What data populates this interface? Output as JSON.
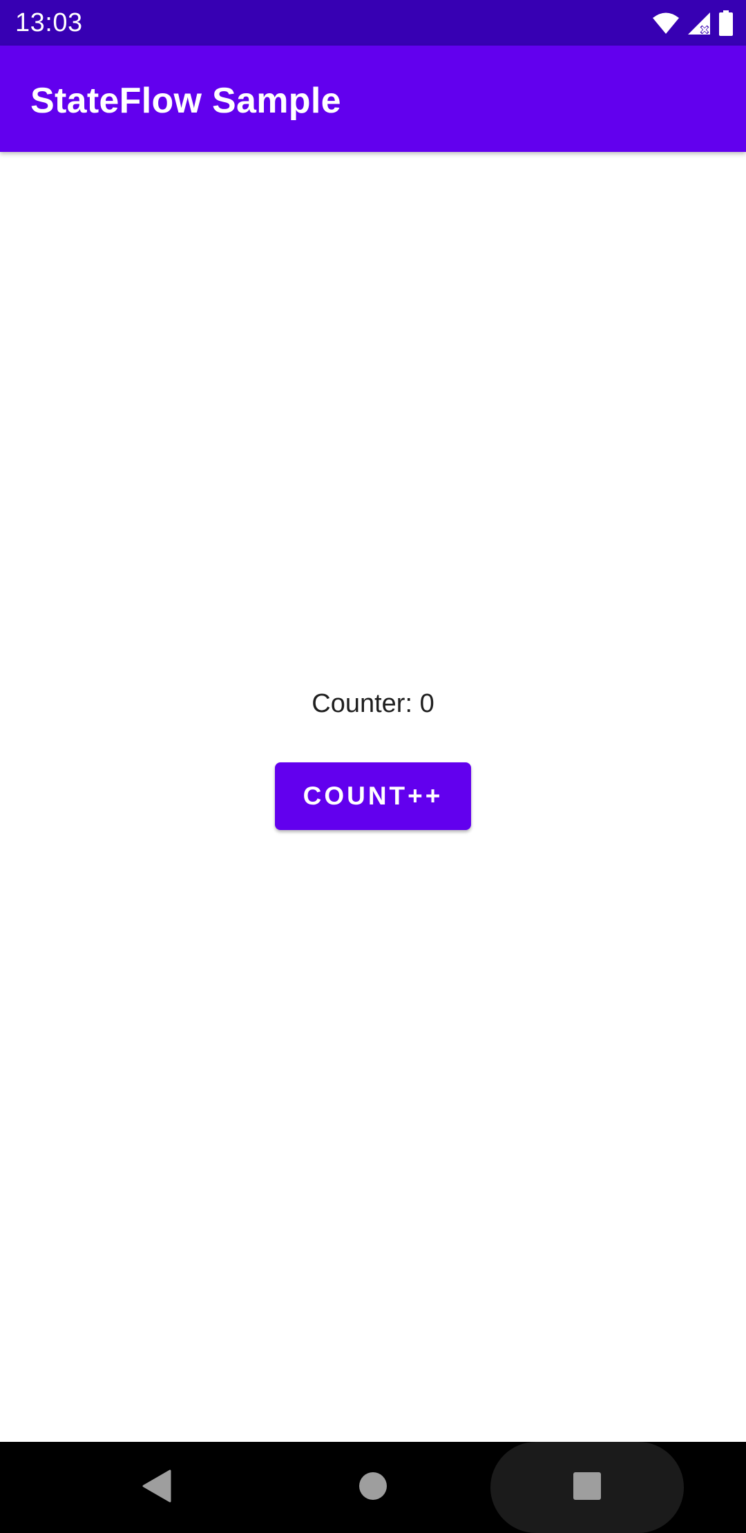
{
  "status_bar": {
    "time": "13:03",
    "icons": [
      "wifi-icon",
      "signal-icon",
      "battery-icon"
    ]
  },
  "app_bar": {
    "title": "StateFlow Sample"
  },
  "main": {
    "counter_text": "Counter: 0",
    "button_label": "COUNT++"
  },
  "nav_bar": {
    "buttons": [
      "back-icon",
      "home-icon",
      "recents-icon"
    ]
  },
  "colors": {
    "status_bar": "#3700b3",
    "primary": "#6200ee",
    "background": "#ffffff",
    "nav_bar": "#000000"
  }
}
